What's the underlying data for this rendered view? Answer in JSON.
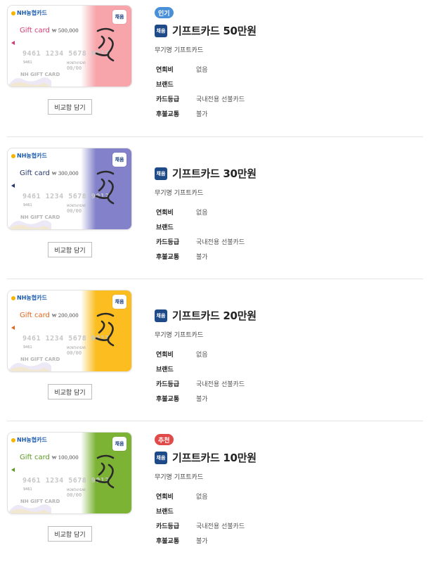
{
  "products": [
    {
      "badge": "인기",
      "badge_color": "#4a90d9",
      "product_icon_text": "채움",
      "name": "기프트카드 50만원",
      "desc": "무기명 기프트카드",
      "compare_button": "비교함 담기",
      "card": {
        "brand_text": "NH농협카드",
        "gift_label": "Gift card",
        "amount_text": "₩ 500,000",
        "number_text": "9461 1234 5678 9012",
        "first4": "9461",
        "month_year_text": "MONTH/YEAR",
        "expiry_text": "00/00",
        "hm_text": "NH GIFT CARD",
        "chaeum_text": "채움",
        "accent_color": "#f7a5ab",
        "label_color": "#d23a73",
        "calligraphy": "행복"
      },
      "specs": [
        {
          "label": "연회비",
          "value": "없음"
        },
        {
          "label": "브랜드",
          "value": ""
        },
        {
          "label": "카드등급",
          "value": "국내전용 선불카드"
        },
        {
          "label": "후불교통",
          "value": "불가"
        }
      ]
    },
    {
      "badge": "",
      "badge_color": "",
      "product_icon_text": "채움",
      "name": "기프트카드 30만원",
      "desc": "무기명 기프트카드",
      "compare_button": "비교함 담기",
      "card": {
        "brand_text": "NH농협카드",
        "gift_label": "Gift card",
        "amount_text": "₩ 300,000",
        "number_text": "9461 1234 5678 9012",
        "first4": "9461",
        "month_year_text": "MONTH/YEAR",
        "expiry_text": "00/00",
        "hm_text": "NH GIFT CARD",
        "chaeum_text": "채움",
        "accent_color": "#8281c9",
        "label_color": "#243670",
        "calligraphy": "행운"
      },
      "specs": [
        {
          "label": "연회비",
          "value": "없음"
        },
        {
          "label": "브랜드",
          "value": ""
        },
        {
          "label": "카드등급",
          "value": "국내전용 선불카드"
        },
        {
          "label": "후불교통",
          "value": "불가"
        }
      ]
    },
    {
      "badge": "",
      "badge_color": "",
      "product_icon_text": "채움",
      "name": "기프트카드 20만원",
      "desc": "무기명 기프트카드",
      "compare_button": "비교함 담기",
      "card": {
        "brand_text": "NH농협카드",
        "gift_label": "Gift card",
        "amount_text": "₩ 200,000",
        "number_text": "9461 1234 5678 9012",
        "first4": "9461",
        "month_year_text": "MONTH/YEAR",
        "expiry_text": "00/00",
        "hm_text": "NH GIFT CARD",
        "chaeum_text": "채움",
        "accent_color": "#fbbd1f",
        "label_color": "#e3651b",
        "calligraphy": "기쁨"
      },
      "specs": [
        {
          "label": "연회비",
          "value": "없음"
        },
        {
          "label": "브랜드",
          "value": ""
        },
        {
          "label": "카드등급",
          "value": "국내전용 선불카드"
        },
        {
          "label": "후불교통",
          "value": "불가"
        }
      ]
    },
    {
      "badge": "추천",
      "badge_color": "#e04a48",
      "product_icon_text": "채움",
      "name": "기프트카드 10만원",
      "desc": "무기명 기프트카드",
      "compare_button": "비교함 담기",
      "card": {
        "brand_text": "NH농협카드",
        "gift_label": "Gift card",
        "amount_text": "₩ 100,000",
        "number_text": "9461 1234 5678 9012",
        "first4": "9461",
        "month_year_text": "MONTH/YEAR",
        "expiry_text": "00/00",
        "hm_text": "NH GIFT CARD",
        "chaeum_text": "채움",
        "accent_color": "#7cb335",
        "label_color": "#5c9a23",
        "calligraphy": "마음"
      },
      "specs": [
        {
          "label": "연회비",
          "value": "없음"
        },
        {
          "label": "브랜드",
          "value": ""
        },
        {
          "label": "카드등급",
          "value": "국내전용 선불카드"
        },
        {
          "label": "후불교통",
          "value": "불가"
        }
      ]
    }
  ]
}
